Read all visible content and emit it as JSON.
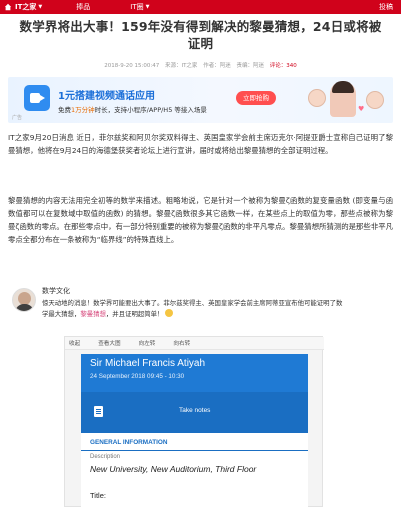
{
  "topbar": {
    "site": "IT之家",
    "nav_items": [
      "捧品",
      "IT圈"
    ],
    "right_label": "投稿"
  },
  "article": {
    "title": "数学界将出大事！159年没有得到解决的黎曼猜想，24日或将被证明",
    "meta": {
      "date": "2018-9-20 15:00:47",
      "source": "来源：IT之家",
      "author": "作者：阿迷",
      "editor": "责编：阿迷",
      "comments": "评论：340"
    },
    "paragraph1": "IT之家9月20日消息 近日，菲尔兹奖和阿贝尔奖双料得主、英国皇家学会前主席迈克尔·阿提亚爵士宣称自己证明了黎曼猜想，他将在9月24日的海德堡获奖者论坛上进行宣讲，届时或将给出黎曼猜想的全部证明过程。",
    "paragraph2": "黎曼猜想的内容无法用完全初等的数学来描述。粗略地说，它是针对一个被称为黎曼ζ函数的复变量函数 (即变量与函数值都可以在复数域中取值的函数) 的猜想。黎曼ζ函数很多其它函数一样，在某些点上的取值为零，那些点被称为黎曼ζ函数的零点。在那些零点中，有一部分特别重要的被称为黎曼ζ函数的非平凡零点。黎曼猜想所猜测的是那些非平凡零点全都分布在一条被称为“临界线”的特殊直线上。"
  },
  "banner": {
    "title": "1元搭建视频通话应用",
    "subtitle_pre": "免费",
    "subtitle_hi": "1万分钟",
    "subtitle_post": "时长，支持小程序/APP/H5 等接入场景",
    "button": "立即抢购",
    "tag": "广告"
  },
  "weibo": {
    "name": "数学文化",
    "text_pre": "惊天动地的消息！数学界可能要出大事了。菲尔兹奖得主、英国皇家学会前主席阿蒂亚宣布他可能证明了数学最大猜想，",
    "text_link": "黎曼猜想",
    "text_post": "，并且证明超简单！"
  },
  "phone": {
    "toolbar": [
      "收起",
      "查看大图",
      "向左转",
      "向右转"
    ],
    "speaker": "Sir Michael Francis Atiyah",
    "time": "24 September 2018 09:45 - 10:30",
    "note_label": "Take notes",
    "section": "GENERAL INFORMATION",
    "desc_label": "Description",
    "desc_value": "New University, New Auditorium, Third Floor",
    "title_label": "Title:"
  },
  "colors": {
    "brand_red": "#d0021b",
    "event_blue": "#1f7ad4"
  }
}
